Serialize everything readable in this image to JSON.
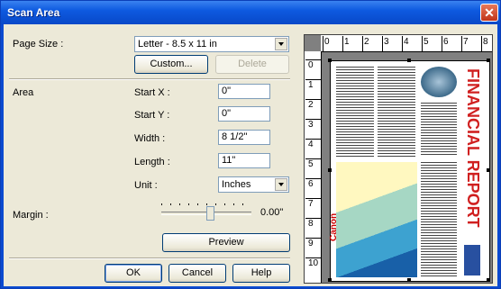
{
  "window": {
    "title": "Scan Area"
  },
  "page_size": {
    "label": "Page Size :",
    "value": "Letter - 8.5 x 11 in"
  },
  "buttons": {
    "custom": "Custom...",
    "delete": "Delete",
    "preview": "Preview",
    "ok": "OK",
    "cancel": "Cancel",
    "help": "Help"
  },
  "area": {
    "label": "Area",
    "start_x_label": "Start X :",
    "start_x": "0\"",
    "start_y_label": "Start Y :",
    "start_y": "0\"",
    "width_label": "Width :",
    "width": "8 1/2\"",
    "length_label": "Length :",
    "length": "11\"",
    "unit_label": "Unit :",
    "unit": "Inches"
  },
  "margin": {
    "label": "Margin :",
    "value": "0.00\"",
    "level": 0.55
  },
  "ruler": {
    "h": [
      "0",
      "1",
      "2",
      "3",
      "4",
      "5",
      "6",
      "7",
      "8"
    ],
    "v": [
      "0",
      "1",
      "2",
      "3",
      "4",
      "5",
      "6",
      "7",
      "8",
      "9",
      "10"
    ]
  },
  "preview_doc": {
    "headline": "FINANCIAL REPORT",
    "brand": "Canon"
  }
}
